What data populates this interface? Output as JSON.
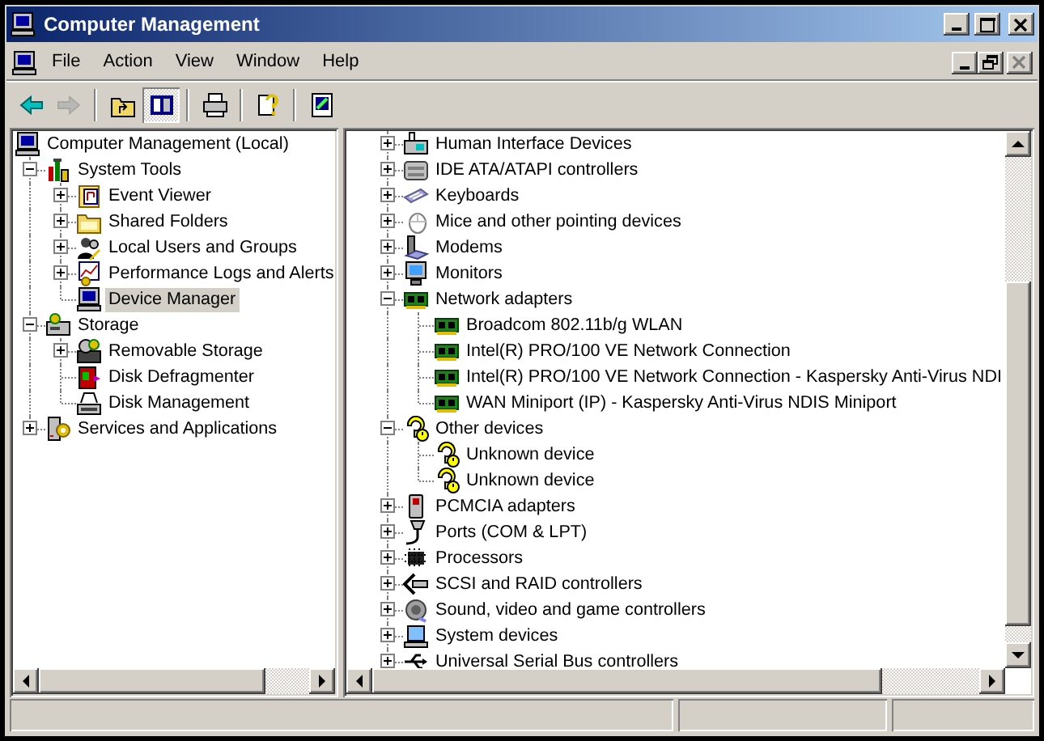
{
  "window": {
    "title": "Computer Management"
  },
  "menu": [
    "File",
    "Action",
    "View",
    "Window",
    "Help"
  ],
  "document_controls": [
    {
      "kind": "minimize",
      "disabled": false
    },
    {
      "kind": "restore",
      "disabled": false
    },
    {
      "kind": "close",
      "disabled": true
    }
  ],
  "toolbar": [
    [
      {
        "kind": "back",
        "disabled": false,
        "pressed": false
      },
      {
        "kind": "forward",
        "disabled": true,
        "pressed": false
      }
    ],
    [
      {
        "kind": "up",
        "disabled": false,
        "pressed": false
      },
      {
        "kind": "tree",
        "disabled": false,
        "pressed": true
      }
    ],
    [
      {
        "kind": "print",
        "disabled": false,
        "pressed": false
      }
    ],
    [
      {
        "kind": "help",
        "disabled": false,
        "pressed": false
      }
    ],
    [
      {
        "kind": "properties",
        "disabled": false,
        "pressed": false
      }
    ]
  ],
  "left_tree": [
    {
      "label": "Computer Management (Local)",
      "kind": "computer",
      "selected": false,
      "children": [
        {
          "label": "System Tools",
          "kind": "tools",
          "expanded": true,
          "selected": false,
          "children": [
            {
              "label": "Event Viewer",
              "kind": "log",
              "expanded": false,
              "selected": false
            },
            {
              "label": "Shared Folders",
              "kind": "folder",
              "expanded": false,
              "selected": false
            },
            {
              "label": "Local Users and Groups",
              "kind": "users",
              "expanded": false,
              "selected": false
            },
            {
              "label": "Performance Logs and Alerts",
              "kind": "chart",
              "expanded": false,
              "selected": false
            },
            {
              "label": "Device Manager",
              "kind": "computer",
              "selected": true
            }
          ]
        },
        {
          "label": "Storage",
          "kind": "storage",
          "expanded": true,
          "selected": false,
          "children": [
            {
              "label": "Removable Storage",
              "kind": "removable",
              "expanded": false,
              "selected": false
            },
            {
              "label": "Disk Defragmenter",
              "kind": "defrag",
              "selected": false
            },
            {
              "label": "Disk Management",
              "kind": "disk",
              "selected": false
            }
          ]
        },
        {
          "label": "Services and Applications",
          "kind": "services",
          "expanded": false,
          "selected": false
        }
      ]
    }
  ],
  "right_tree": [
    {
      "label": "Human Interface Devices",
      "kind": "hid",
      "expanded": false,
      "selected": false
    },
    {
      "label": "IDE ATA/ATAPI controllers",
      "kind": "ide",
      "expanded": false,
      "selected": false
    },
    {
      "label": "Keyboards",
      "kind": "keyboard",
      "expanded": false,
      "selected": false
    },
    {
      "label": "Mice and other pointing devices",
      "kind": "mouse",
      "expanded": false,
      "selected": false
    },
    {
      "label": "Modems",
      "kind": "modem",
      "expanded": false,
      "selected": false
    },
    {
      "label": "Monitors",
      "kind": "monitor",
      "expanded": false,
      "selected": false
    },
    {
      "label": "Network adapters",
      "kind": "network",
      "expanded": true,
      "selected": false,
      "children": [
        {
          "label": "Broadcom 802.11b/g WLAN",
          "kind": "network",
          "selected": false
        },
        {
          "label": "Intel(R) PRO/100 VE Network Connection",
          "kind": "network",
          "selected": false
        },
        {
          "label": "Intel(R) PRO/100 VE Network Connection - Kaspersky Anti-Virus NDI",
          "kind": "network",
          "selected": false
        },
        {
          "label": "WAN Miniport (IP) - Kaspersky Anti-Virus NDIS Miniport",
          "kind": "network",
          "selected": false
        }
      ]
    },
    {
      "label": "Other devices",
      "kind": "unknown",
      "expanded": true,
      "selected": false,
      "children": [
        {
          "label": "Unknown device",
          "kind": "unknown",
          "selected": false
        },
        {
          "label": "Unknown device",
          "kind": "unknown",
          "selected": false
        }
      ]
    },
    {
      "label": "PCMCIA adapters",
      "kind": "pcmcia",
      "expanded": false,
      "selected": false
    },
    {
      "label": "Ports (COM & LPT)",
      "kind": "port",
      "expanded": false,
      "selected": false
    },
    {
      "label": "Processors",
      "kind": "processor",
      "expanded": false,
      "selected": false
    },
    {
      "label": "SCSI and RAID controllers",
      "kind": "scsi",
      "expanded": false,
      "selected": false
    },
    {
      "label": "Sound, video and game controllers",
      "kind": "sound",
      "expanded": false,
      "selected": false
    },
    {
      "label": "System devices",
      "kind": "system",
      "expanded": false,
      "selected": false
    },
    {
      "label": "Universal Serial Bus controllers",
      "kind": "usb",
      "expanded": false,
      "selected": false
    }
  ]
}
